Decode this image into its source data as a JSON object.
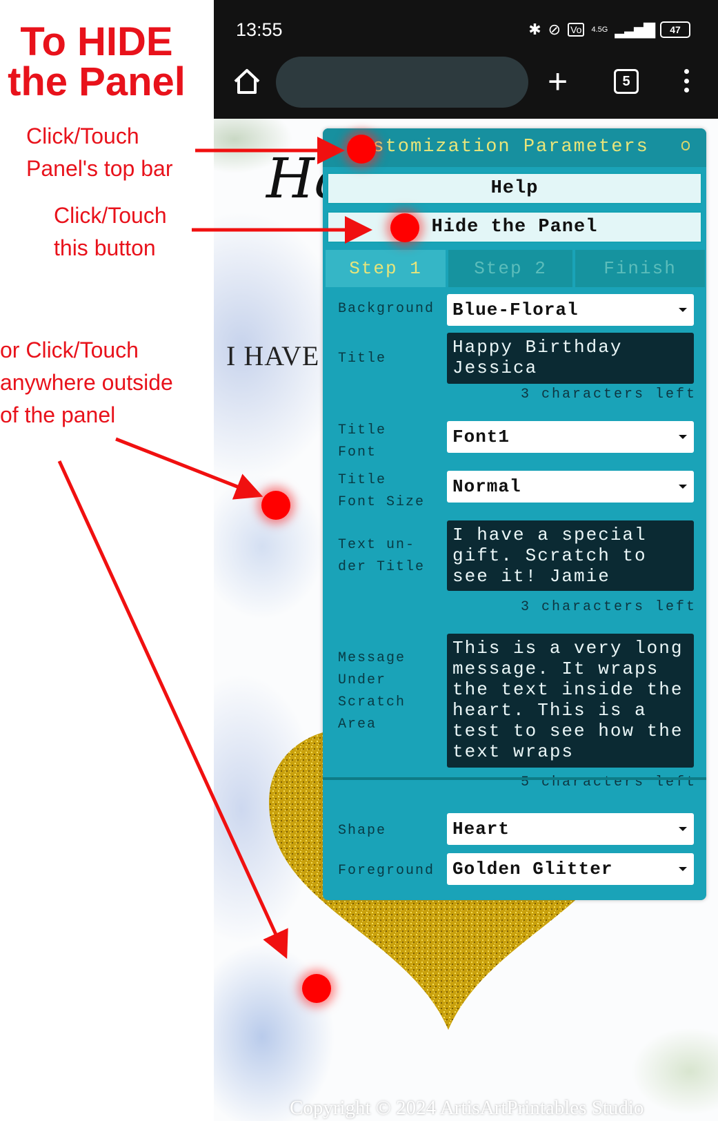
{
  "annotations": {
    "title": "To HIDE\nthe Panel",
    "top_bar_hint": "Click/Touch\nPanel's top bar",
    "button_hint": "Click/Touch\nthis button",
    "outside_hint": "or Click/Touch\nanywhere outside\nof the panel",
    "color": "#e8121b"
  },
  "status_bar": {
    "time": "13:55",
    "network": "4.5G",
    "battery": "47"
  },
  "browser": {
    "tab_count": "5"
  },
  "webpage": {
    "heading": "Ha",
    "intro": "I HAVE",
    "copyright": "Copyright © 2024 ArtisArtPrintables Studio"
  },
  "panel": {
    "title": "Customization Parameters",
    "help_button": "Help",
    "hide_button": "Hide the Panel",
    "tabs": [
      "Step 1",
      "Step 2",
      "Finish"
    ],
    "background_label": "Background",
    "background_value": "Blue-Floral",
    "title_label": "Title",
    "title_value": "Happy Birthday Jessica",
    "title_count": "3 characters left",
    "title_font_label": "Title Font",
    "title_font_value": "Font1",
    "title_font_size_label": "Title Font Size",
    "title_font_size_value": "Normal",
    "subtitle_label": "Text un-der Title",
    "subtitle_value": "I have a special gift. Scratch to see it! Jamie",
    "subtitle_count": "3 characters left",
    "message_label": "Message Under Scratch Area",
    "message_value": "This is a very long message. It wraps the text inside the heart. This is a test to see how the text wraps",
    "message_count": "5 characters left",
    "shape_label": "Shape",
    "shape_value": "Heart",
    "foreground_label": "Foreground",
    "foreground_value": "Golden Glitter",
    "colors": {
      "panel": "#1aa3b8",
      "accent": "#e8e57a",
      "textarea": "#0b2a33"
    }
  }
}
